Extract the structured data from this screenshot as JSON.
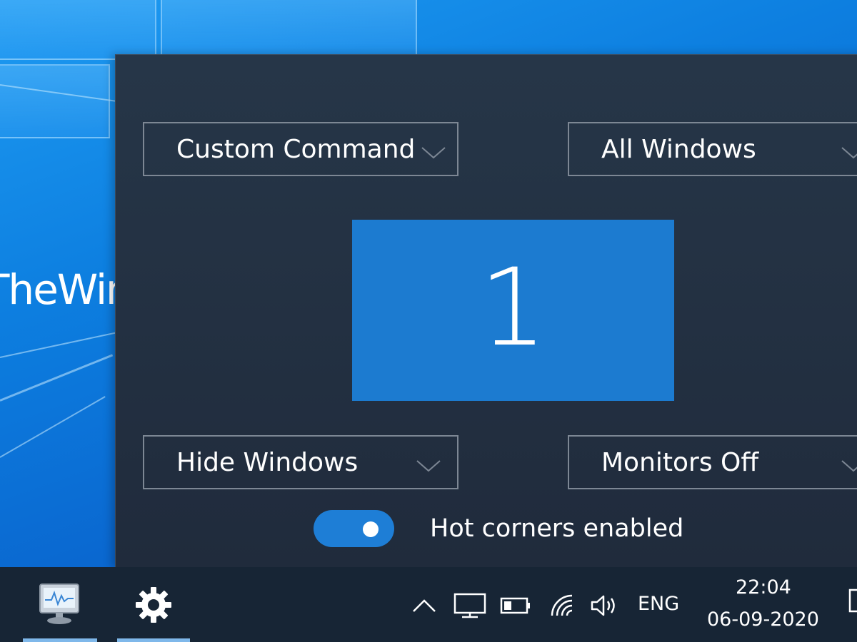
{
  "watermark": {
    "text": "TheWindowsClub"
  },
  "hot_corners": {
    "top_left": {
      "selected": "Custom Command"
    },
    "top_right": {
      "selected": "All Windows"
    },
    "bottom_left": {
      "selected": "Hide Windows"
    },
    "bottom_right": {
      "selected": "Monitors Off"
    },
    "monitor_number": "1",
    "toggle": {
      "label": "Hot corners enabled",
      "enabled": true
    }
  },
  "taskbar": {
    "apps": [
      {
        "icon": "system-monitor-icon",
        "active": true
      },
      {
        "icon": "gear-icon",
        "active": true
      }
    ],
    "tray": {
      "icons": [
        "chevron-up-icon",
        "display-icon",
        "battery-icon",
        "wifi-icon",
        "volume-icon"
      ],
      "language": "ENG",
      "time": "22:04",
      "date": "06-09-2020"
    }
  },
  "colors": {
    "panel_bg": "#222d3e",
    "accent": "#1c7bd0",
    "taskbar_bg": "#172535",
    "wallpaper": "#0d7fe0"
  }
}
